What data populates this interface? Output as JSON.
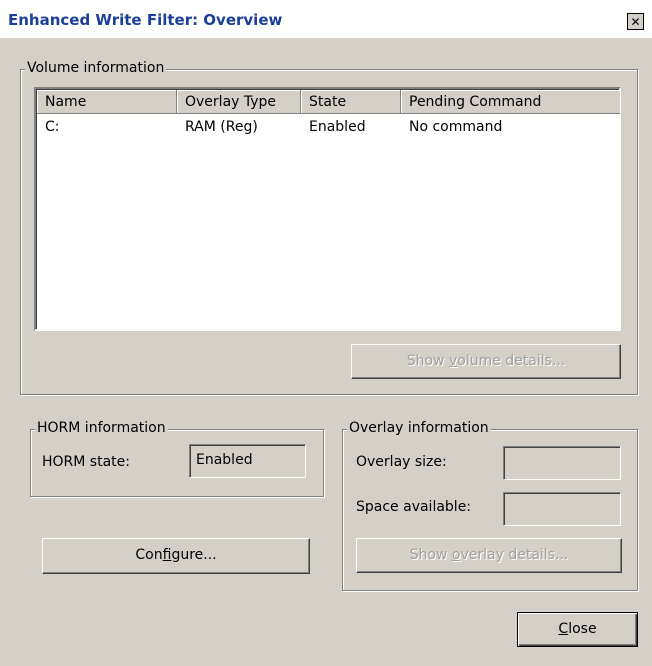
{
  "window": {
    "title": "Enhanced Write Filter: Overview",
    "close_glyph": "✕"
  },
  "volume": {
    "group_label": "Volume information",
    "columns": [
      "Name",
      "Overlay Type",
      "State",
      "Pending Command"
    ],
    "rows": [
      [
        "C:",
        "RAM (Reg)",
        "Enabled",
        "No command"
      ]
    ],
    "details_button": {
      "pre": "Show ",
      "accel": "v",
      "post": "olume details..."
    }
  },
  "horm": {
    "group_label": "HORM information",
    "state_label": "HORM state:",
    "state_value": "Enabled"
  },
  "overlay": {
    "group_label": "Overlay information",
    "size_label": "Overlay size:",
    "size_value": "",
    "space_label": "Space available:",
    "space_value": "",
    "details_button": {
      "pre": "Show ",
      "accel": "o",
      "post": "verlay details..."
    }
  },
  "configure_button": {
    "pre": "Con",
    "accel": "f",
    "post": "igure..."
  },
  "close_button": {
    "pre": "",
    "accel": "C",
    "post": "lose"
  },
  "colors": {
    "title_text": "#1c3f9a",
    "face": "#d4d0c8",
    "disabled_text": "#a0a0a0"
  }
}
